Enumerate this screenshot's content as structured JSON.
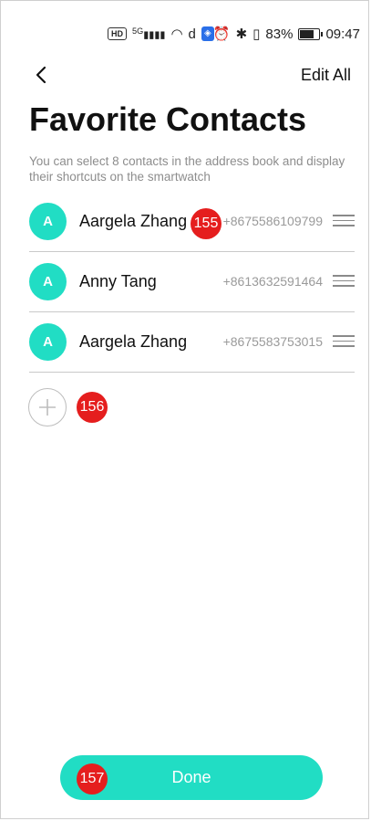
{
  "status_bar": {
    "network": "5G",
    "hd": "HD",
    "battery": "83%",
    "time": "09:47"
  },
  "header": {
    "back_icon": "chevron-left-icon",
    "edit_all": "Edit All",
    "title": "Favorite Contacts",
    "subtitle": "You can select 8 contacts in the address book and display their shortcuts on the smartwatch"
  },
  "contacts": [
    {
      "initial": "A",
      "name": "Aargela Zhang",
      "phone": "+8675586109799"
    },
    {
      "initial": "A",
      "name": "Anny Tang",
      "phone": "+8613632591464"
    },
    {
      "initial": "A",
      "name": "Aargela Zhang",
      "phone": "+8675583753015"
    }
  ],
  "badges": {
    "b155": "155",
    "b156": "156",
    "b157": "157"
  },
  "footer": {
    "done": "Done"
  },
  "colors": {
    "accent": "#21ddc4",
    "badge": "#e51e1e"
  }
}
